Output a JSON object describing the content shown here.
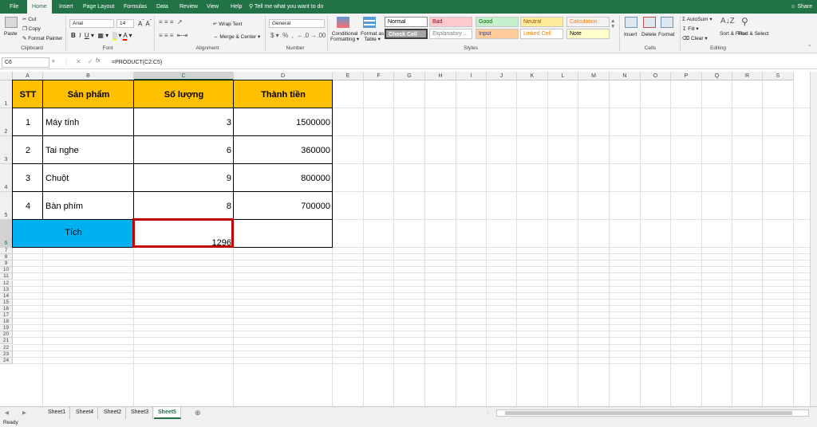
{
  "ribbon_tabs": [
    "File",
    "Home",
    "Insert",
    "Page Layout",
    "Formulas",
    "Data",
    "Review",
    "View",
    "Help"
  ],
  "active_tab": "Home",
  "tell_me": "Tell me what you want to do",
  "share": "Share",
  "clipboard": {
    "paste": "Paste",
    "cut": "Cut",
    "copy": "Copy",
    "format_painter": "Format Painter",
    "label": "Clipboard"
  },
  "font": {
    "name": "Arial",
    "size": "14",
    "label": "Font"
  },
  "alignment": {
    "wrap_text": "Wrap Text",
    "merge_center": "Merge & Center",
    "label": "Alignment"
  },
  "number": {
    "format": "General",
    "label": "Number"
  },
  "styles": {
    "conditional": "Conditional Formatting",
    "format_as_table": "Format as Table",
    "label": "Styles",
    "cells": [
      {
        "name": "Normal",
        "bg": "#ffffff",
        "fg": "#000000"
      },
      {
        "name": "Bad",
        "bg": "#ffc7ce",
        "fg": "#9c0006"
      },
      {
        "name": "Good",
        "bg": "#c6efce",
        "fg": "#006100"
      },
      {
        "name": "Neutral",
        "bg": "#ffeb9c",
        "fg": "#9c5700"
      },
      {
        "name": "Calculation",
        "bg": "#f2f2f2",
        "fg": "#fa7d00"
      },
      {
        "name": "Check Cell",
        "bg": "#a5a5a5",
        "fg": "#ffffff"
      },
      {
        "name": "Explanatory ...",
        "bg": "#ffffff",
        "fg": "#7f7f7f"
      },
      {
        "name": "Input",
        "bg": "#ffcc99",
        "fg": "#3f3f76"
      },
      {
        "name": "Linked Cell",
        "bg": "#ffffff",
        "fg": "#fa7d00"
      },
      {
        "name": "Note",
        "bg": "#ffffcc",
        "fg": "#000000"
      }
    ]
  },
  "cells_group": {
    "insert": "Insert",
    "delete": "Delete",
    "format": "Format",
    "label": "Cells"
  },
  "editing": {
    "autosum": "AutoSum",
    "fill": "Fill",
    "clear": "Clear",
    "sort_filter": "Sort & Filter",
    "find_select": "Find & Select",
    "label": "Editing"
  },
  "formula_bar": {
    "name_box": "C6",
    "formula": "=PRODUCT(C2:C5)"
  },
  "columns": [
    "A",
    "B",
    "C",
    "D",
    "E",
    "F",
    "G",
    "H",
    "I",
    "J",
    "K",
    "L",
    "M",
    "N",
    "O",
    "P",
    "Q",
    "R",
    "S"
  ],
  "rows": [
    "1",
    "2",
    "3",
    "4",
    "5",
    "6",
    "7",
    "8",
    "9",
    "10",
    "11",
    "12",
    "13",
    "14",
    "15",
    "16",
    "17",
    "18",
    "19",
    "20",
    "21",
    "22",
    "23",
    "24"
  ],
  "table": {
    "headers": [
      "STT",
      "Sản phẩm",
      "Số lượng",
      "Thành tiền"
    ],
    "rows": [
      {
        "stt": "1",
        "product": "Máy tính",
        "qty": "3",
        "amount": "1500000"
      },
      {
        "stt": "2",
        "product": "Tai nghe",
        "qty": "6",
        "amount": "360000"
      },
      {
        "stt": "3",
        "product": "Chuột",
        "qty": "9",
        "amount": "800000"
      },
      {
        "stt": "4",
        "product": "Bàn phím",
        "qty": "8",
        "amount": "700000"
      }
    ],
    "total_label": "Tích",
    "total_value": "1296",
    "header_color": "#ffc000",
    "total_label_color": "#00b0f0",
    "selection_color": "#c00000"
  },
  "sheets": [
    "Sheet1",
    "Sheet4",
    "Sheet2",
    "Sheet3",
    "Sheet5"
  ],
  "active_sheet": "Sheet5",
  "status": "Ready"
}
